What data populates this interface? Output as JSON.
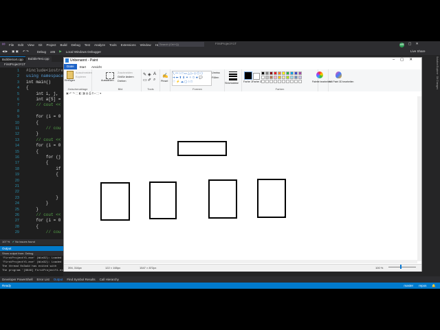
{
  "vs": {
    "menu": [
      "File",
      "Edit",
      "View",
      "Git",
      "Project",
      "Build",
      "Debug",
      "Test",
      "Analyze",
      "Tools",
      "Extensions",
      "Window",
      "Help"
    ],
    "search_placeholder": "Search (Ctrl+Q)",
    "project_title": "FirstProjectY1T",
    "avatar_initials": "MM",
    "toolbar": {
      "config": "Debug",
      "platform": "x86",
      "run_label": "Local Windows Debugger",
      "live_share": "Live Share"
    },
    "tabs": [
      "BubbleSort.cpp",
      "BubbleTest.cpp"
    ],
    "scope": "FirstProjectY1T",
    "line_numbers": [
      "1",
      "2",
      "3",
      "4",
      "5",
      "6",
      "7",
      "8",
      "9",
      "10",
      "11",
      "12",
      "13",
      "14",
      "15",
      "16",
      "17",
      "18",
      "19",
      "20",
      "21",
      "22",
      "23",
      "24",
      "25",
      "26",
      "27",
      "28",
      "29"
    ],
    "code_lines": [
      {
        "text": "#include<iostream>",
        "cls": "pp"
      },
      {
        "text": "using namespace",
        "cls": "kw"
      },
      {
        "text": "int main()",
        "cls": ""
      },
      {
        "text": "{",
        "cls": ""
      },
      {
        "text": "    int i, j,",
        "cls": ""
      },
      {
        "text": "    int a[5] =",
        "cls": ""
      },
      {
        "text": "    // cout <<",
        "cls": "cm"
      },
      {
        "text": "",
        "cls": ""
      },
      {
        "text": "    for (i = 0",
        "cls": ""
      },
      {
        "text": "    {",
        "cls": ""
      },
      {
        "text": "        // cou",
        "cls": "cm"
      },
      {
        "text": "    }",
        "cls": ""
      },
      {
        "text": "    // cout <<",
        "cls": "cm"
      },
      {
        "text": "    for (i = 0",
        "cls": ""
      },
      {
        "text": "    {",
        "cls": ""
      },
      {
        "text": "        for (j",
        "cls": ""
      },
      {
        "text": "        {",
        "cls": ""
      },
      {
        "text": "            if",
        "cls": ""
      },
      {
        "text": "            {",
        "cls": ""
      },
      {
        "text": "",
        "cls": ""
      },
      {
        "text": "",
        "cls": ""
      },
      {
        "text": "",
        "cls": ""
      },
      {
        "text": "            }",
        "cls": ""
      },
      {
        "text": "        }",
        "cls": ""
      },
      {
        "text": "    }",
        "cls": ""
      },
      {
        "text": "    // cout <<",
        "cls": "cm"
      },
      {
        "text": "    for (i = 0",
        "cls": ""
      },
      {
        "text": "    {",
        "cls": ""
      },
      {
        "text": "        // cou",
        "cls": "cm"
      }
    ],
    "editor_status": {
      "zoom": "107 %",
      "issues": "No issues found"
    },
    "output": {
      "title": "Output",
      "source": "Show output from:  Debug",
      "lines": [
        "'FirstProjectY1.exe' (Win32): Loaded",
        "'FirstProjectY1.exe' (Win32): Loaded",
        "The thread 0x3a4d has exited with",
        "The program '[8848] FirstProjectY1.ex"
      ]
    },
    "bottom_tabs": [
      "Developer PowerShell",
      "Error List",
      "Output",
      "Find Symbol Results",
      "Call Hierarchy"
    ],
    "status": {
      "ready": "Ready",
      "git_branch": "master",
      "repo": "repos"
    },
    "right_panel_labels": [
      "Solution Explorer",
      "Git Changes"
    ]
  },
  "paint": {
    "title": "Unbenannt - Paint",
    "ribbon_tabs": [
      "Datei",
      "Start",
      "Ansicht"
    ],
    "groups": {
      "clipboard": {
        "label": "Zwischenablage",
        "paste": "Einfügen",
        "cut": "Ausschneiden",
        "copy": "Kopieren"
      },
      "image": {
        "label": "Bild",
        "select": "Auswählen",
        "crop": "Zuschneiden",
        "resize": "Größe ändern",
        "rotate": "Drehen"
      },
      "tools": {
        "label": "Tools"
      },
      "brushes": {
        "label": "Pinsel"
      },
      "shapes": {
        "label": "Formen",
        "outline": "Umriss",
        "fill": "Füllen"
      },
      "size": {
        "label": "Strichstärke"
      },
      "colors": {
        "label": "Farben",
        "color1": "Farbe 1",
        "color2": "Farbe 2",
        "edit_colors": "Palette bearbeiten",
        "paint3d": "Mit Paint 3D bearbeiten"
      }
    },
    "palette": [
      "#000000",
      "#7f7f7f",
      "#880015",
      "#ed1c24",
      "#ff7f27",
      "#fff200",
      "#22b14c",
      "#00a2e8",
      "#3f48cc",
      "#a349a4",
      "#ffffff",
      "#c3c3c3",
      "#b97a57",
      "#ffaec9",
      "#ffc90e",
      "#efe4b0",
      "#b5e61d",
      "#99d9ea",
      "#7092be",
      "#c8bfe7"
    ],
    "status": {
      "cursor": "394, 316px",
      "selection": "122 × 165px",
      "canvas_size": "1547 × 872px",
      "zoom": "100 %"
    }
  }
}
